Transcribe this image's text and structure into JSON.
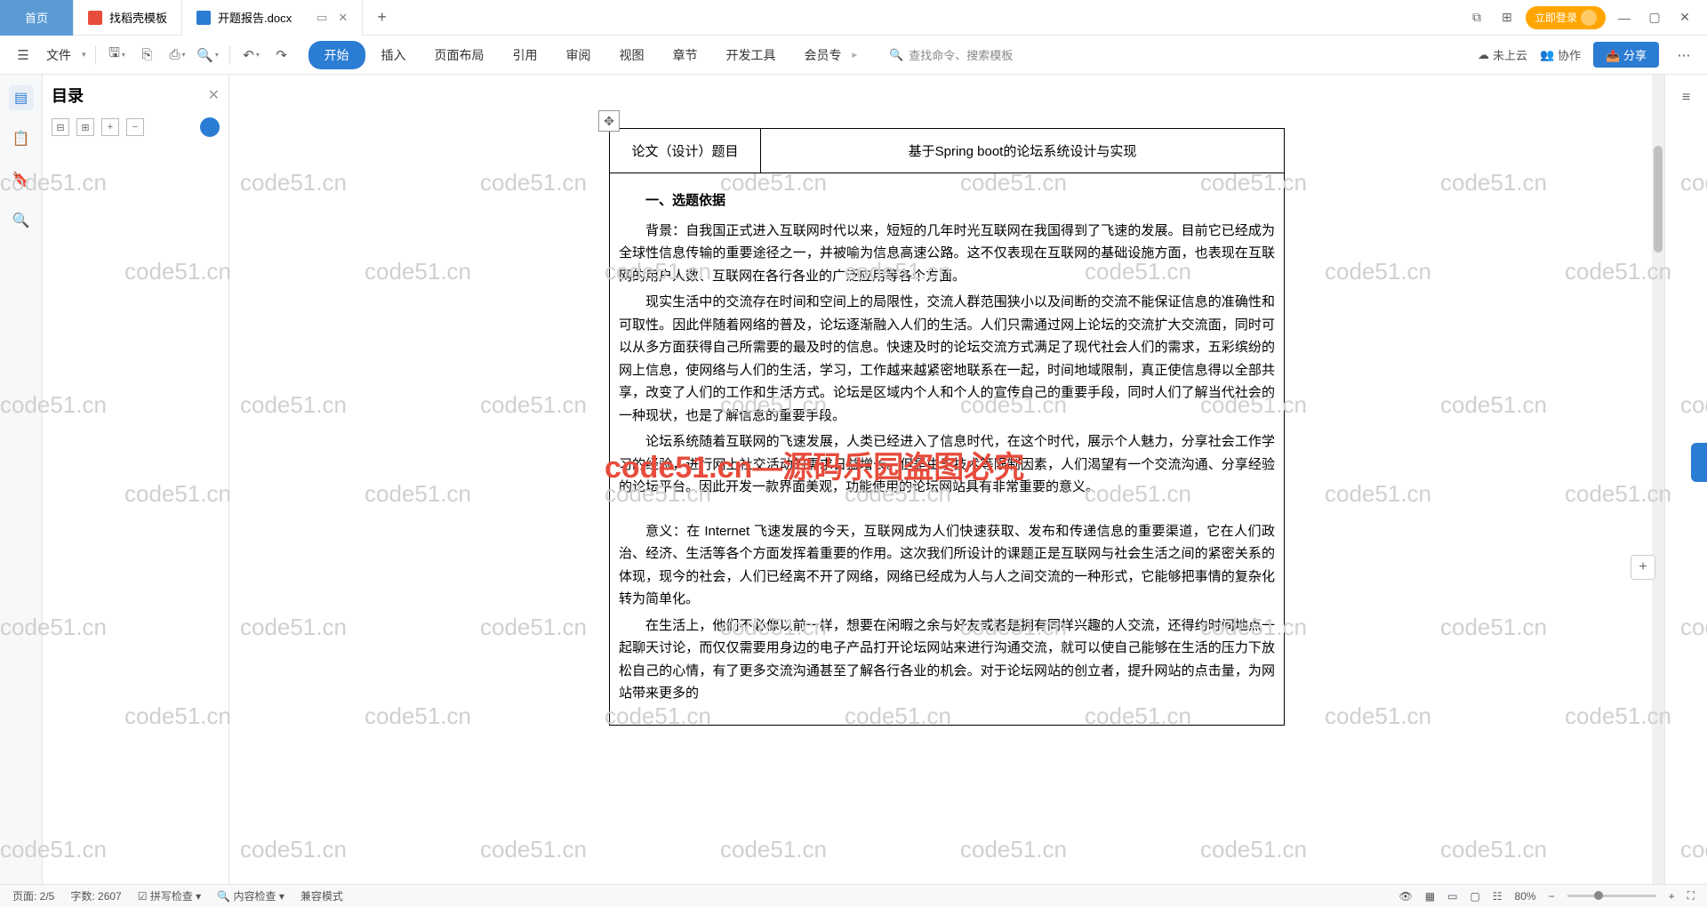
{
  "tabs": {
    "home": "首页",
    "template": "找稻壳模板",
    "doc": "开题报告.docx"
  },
  "login": "立即登录",
  "file_menu": "文件",
  "menu": [
    "开始",
    "插入",
    "页面布局",
    "引用",
    "审阅",
    "视图",
    "章节",
    "开发工具",
    "会员专"
  ],
  "search_placeholder": "查找命令、搜索模板",
  "right_tools": {
    "cloud": "未上云",
    "collab": "协作",
    "share": "分享"
  },
  "sidebar": {
    "title": "目录"
  },
  "doc": {
    "cell_label": "论文（设计）题目",
    "cell_value": "基于Spring boot的论坛系统设计与实现",
    "h1": "一、选题依据",
    "p1": "背景：自我国正式进入互联网时代以来，短短的几年时光互联网在我国得到了飞速的发展。目前它已经成为全球性信息传输的重要途径之一，并被喻为信息高速公路。这不仅表现在互联网的基础设施方面，也表现在互联网的用户人数、互联网在各行各业的广泛应用等各个方面。",
    "p2": "现实生活中的交流存在时间和空间上的局限性，交流人群范围狭小以及间断的交流不能保证信息的准确性和可取性。因此伴随着网络的普及，论坛逐渐融入人们的生活。人们只需通过网上论坛的交流扩大交流面，同时可以从多方面获得自己所需要的最及时的信息。快速及时的论坛交流方式满足了现代社会人们的需求，五彩缤纷的网上信息，使网络与人们的生活，学习，工作越来越紧密地联系在一起，时间地域限制，真正使信息得以全部共享，改变了人们的工作和生活方式。论坛是区域内个人和个人的宣传自己的重要手段，同时人们了解当代社会的一种现状，也是了解信息的重要手段。",
    "p3": "论坛系统随着互联网的飞速发展，人类已经进入了信息时代，在这个时代，展示个人魅力，分享社会工作学习的经验，进行网上社交活动的需求日益增长。但是由于技术等限制因素，人们渴望有一个交流沟通、分享经验的论坛平台。因此开发一款界面美观，功能使用的论坛网站具有非常重要的意义。",
    "p4": "意义：在 Internet 飞速发展的今天，互联网成为人们快速获取、发布和传递信息的重要渠道，它在人们政治、经济、生活等各个方面发挥着重要的作用。这次我们所设计的课题正是互联网与社会生活之间的紧密关系的体现，现今的社会，人们已经离不开了网络，网络已经成为人与人之间交流的一种形式，它能够把事情的复杂化转为简单化。",
    "p5": "在生活上，他们不必像以前一样，想要在闲暇之余与好友或者是拥有同样兴趣的人交流，还得约时间地点一起聊天讨论，而仅仅需要用身边的电子产品打开论坛网站来进行沟通交流，就可以使自己能够在生活的压力下放松自己的心情，有了更多交流沟通甚至了解各行各业的机会。对于论坛网站的创立者，提升网站的点击量，为网站带来更多的"
  },
  "status": {
    "page": "页面: 2/5",
    "words": "字数: 2607",
    "spell": "拼写检查",
    "content": "内容检查",
    "compat": "兼容模式",
    "zoom": "80%"
  },
  "watermark": "code51.cn",
  "watermark_red": "code51.cn—源码乐园盗图必究"
}
